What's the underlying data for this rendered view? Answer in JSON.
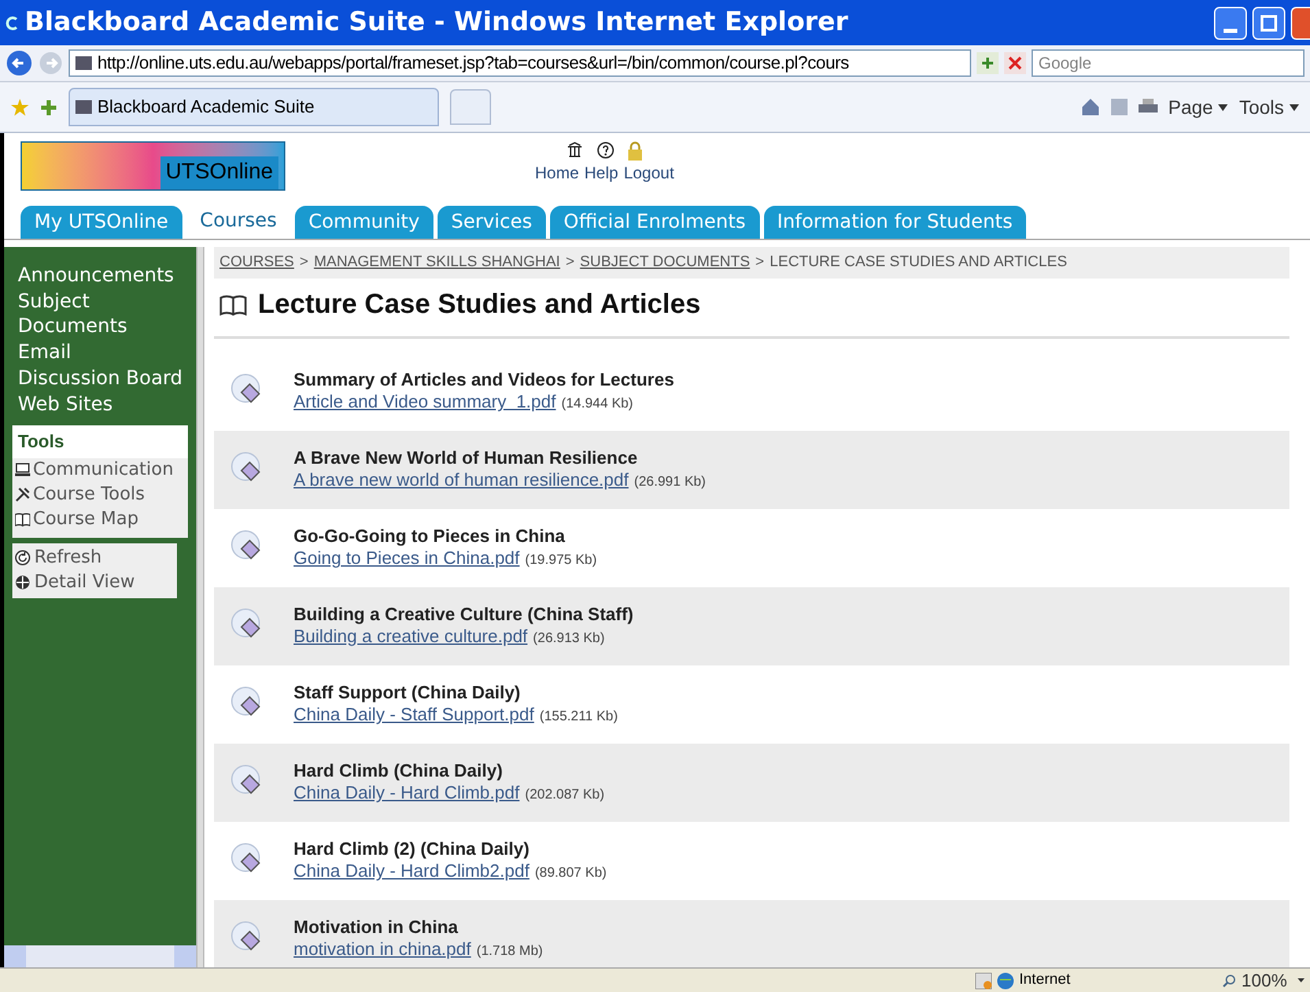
{
  "window": {
    "title": "Blackboard Academic Suite - Windows Internet Explorer"
  },
  "address_bar": {
    "url": "http://online.uts.edu.au/webapps/portal/frameset.jsp?tab=courses&url=/bin/common/course.pl?cours",
    "search_placeholder": "Google"
  },
  "browser_tab": {
    "label": "Blackboard Academic Suite"
  },
  "command_bar": {
    "page": "Page",
    "tools": "Tools"
  },
  "header": {
    "logo": "UTSOnline",
    "links": [
      "Home",
      "Help",
      "Logout"
    ]
  },
  "tabs": [
    {
      "label": "My UTSOnline",
      "selected": false
    },
    {
      "label": "Courses",
      "selected": true
    },
    {
      "label": "Community",
      "selected": false
    },
    {
      "label": "Services",
      "selected": false
    },
    {
      "label": "Official Enrolments",
      "selected": false
    },
    {
      "label": "Information for Students",
      "selected": false
    }
  ],
  "sidebar": {
    "items": [
      "Announcements",
      "Subject Documents",
      "Email",
      "Discussion Board",
      "Web Sites"
    ],
    "tools": {
      "title": "Tools",
      "items": [
        "Communication",
        "Course Tools",
        "Course Map"
      ]
    },
    "actions": [
      "Refresh",
      "Detail View"
    ]
  },
  "breadcrumb": {
    "separator": ">",
    "items": [
      {
        "label": "COURSES",
        "link": true
      },
      {
        "label": "MANAGEMENT SKILLS SHANGHAI",
        "link": true
      },
      {
        "label": "SUBJECT DOCUMENTS",
        "link": true
      },
      {
        "label": "LECTURE CASE STUDIES AND ARTICLES",
        "link": false
      }
    ]
  },
  "page_title": "Lecture Case Studies and Articles",
  "documents": [
    {
      "title": "Summary of Articles and Videos for Lectures",
      "file": "Article and Video summary  1.pdf",
      "size": "(14.944 Kb)"
    },
    {
      "title": "A Brave New World of Human Resilience",
      "file": "A brave new world of human resilience.pdf",
      "size": "(26.991 Kb)"
    },
    {
      "title": "Go-Go-Going to Pieces in China",
      "file": "Going to Pieces in China.pdf",
      "size": "(19.975 Kb)"
    },
    {
      "title": "Building a Creative Culture (China Staff)",
      "file": "Building a creative culture.pdf",
      "size": "(26.913 Kb)"
    },
    {
      "title": "Staff Support (China Daily)",
      "file": "China Daily - Staff Support.pdf",
      "size": "(155.211 Kb)"
    },
    {
      "title": "Hard Climb (China Daily)",
      "file": "China Daily - Hard Climb.pdf",
      "size": "(202.087 Kb)"
    },
    {
      "title": "Hard Climb (2) (China Daily)",
      "file": "China Daily - Hard Climb2.pdf",
      "size": "(89.807 Kb)"
    },
    {
      "title": "Motivation in China",
      "file": "motivation in china.pdf",
      "size": "(1.718 Mb)"
    }
  ],
  "status_bar": {
    "zone": "Internet",
    "zoom": "100%"
  }
}
